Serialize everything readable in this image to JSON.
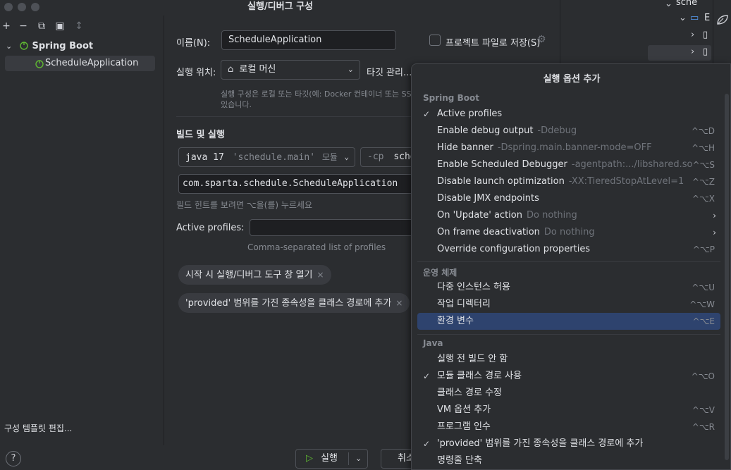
{
  "window": {
    "title": "실행/디버그 구성"
  },
  "background_ide": {
    "row1": "sche",
    "row2": "E"
  },
  "left": {
    "tree_group": "Spring Boot",
    "tree_item": "ScheduleApplication",
    "edit_templates_link": "구성 템플릿 편집..."
  },
  "form": {
    "name_label": "이름(N):",
    "name_value": "ScheduleApplication",
    "store_label": "프로젝트 파일로 저장(S)",
    "run_on_label": "실행 위치:",
    "run_on_value": "로컬 머신",
    "manage_targets": "타깃 관리...",
    "run_on_hint_1": "실행 구성은 로컬 또는 타깃(예: Docker 컨테이너 또는 SS",
    "run_on_hint_2": "있습니다.",
    "build_section": "빌드 및 실행",
    "jdk_java": "java 17",
    "jdk_module": "'schedule.main'",
    "jdk_suffix": "모듈",
    "cp_prefix": "-cp",
    "cp_value": "sche",
    "main_class": "com.sparta.schedule.ScheduleApplication",
    "build_hint": "필드 힌트를 보려면 ⌥을(를) 누르세요",
    "active_profiles_label": "Active profiles:",
    "active_profiles_value": "",
    "active_profiles_hint": "Comma-separated list of profiles",
    "chip1": "시작 시 실행/디버그 도구 창 열기",
    "chip2": "'provided' 범위를 가진 종속성을 클래스 경로에 추가",
    "chip_close": "×"
  },
  "bottom": {
    "help": "?",
    "run_button": "실행",
    "cancel_button": "취소"
  },
  "popup": {
    "title": "실행 옵션 추가",
    "groups": {
      "spring": "Spring Boot",
      "os": "운영 체제",
      "java": "Java"
    },
    "spring_items": [
      {
        "check": "✓",
        "name": "Active profiles",
        "sub": "",
        "key": ""
      },
      {
        "check": "",
        "name": "Enable debug output",
        "sub": "-Ddebug",
        "key": "^⌥D"
      },
      {
        "check": "",
        "name": "Hide banner",
        "sub": "-Dspring.main.banner-mode=OFF",
        "key": "^⌥H"
      },
      {
        "check": "",
        "name": "Enable Scheduled Debugger",
        "sub": "-agentpath:.../libshared.so",
        "key": "^⌥S"
      },
      {
        "check": "",
        "name": "Disable launch optimization",
        "sub": "-XX:TieredStopAtLevel=1",
        "key": "^⌥Z"
      },
      {
        "check": "",
        "name": "Disable JMX endpoints",
        "sub": "",
        "key": "^⌥X"
      },
      {
        "check": "",
        "name": "On 'Update' action",
        "sub": "Do nothing",
        "key": ""
      },
      {
        "check": "",
        "name": "On frame deactivation",
        "sub": "Do nothing",
        "key": ""
      },
      {
        "check": "",
        "name": "Override configuration properties",
        "sub": "",
        "key": "^⌥P"
      }
    ],
    "os_items": [
      {
        "check": "",
        "name": "다중 인스턴스 허용",
        "sub": "",
        "key": "^⌥U"
      },
      {
        "check": "",
        "name": "작업 디렉터리",
        "sub": "",
        "key": "^⌥W"
      },
      {
        "check": "",
        "name": "환경 변수",
        "sub": "",
        "key": "^⌥E"
      }
    ],
    "java_items": [
      {
        "check": "",
        "name": "실행 전 빌드 안 함",
        "sub": "",
        "key": ""
      },
      {
        "check": "✓",
        "name": "모듈 클래스 경로 사용",
        "sub": "",
        "key": "^⌥O"
      },
      {
        "check": "",
        "name": "클래스 경로 수정",
        "sub": "",
        "key": ""
      },
      {
        "check": "",
        "name": "VM 옵션 추가",
        "sub": "",
        "key": "^⌥V"
      },
      {
        "check": "",
        "name": "프로그램 인수",
        "sub": "",
        "key": "^⌥R"
      },
      {
        "check": "✓",
        "name": "'provided' 범위를 가진 종속성을 클래스 경로에 추가",
        "sub": "",
        "key": ""
      },
      {
        "check": "",
        "name": "명령줄 단축",
        "sub": "",
        "key": ""
      }
    ],
    "submenu_arrow": "›"
  }
}
